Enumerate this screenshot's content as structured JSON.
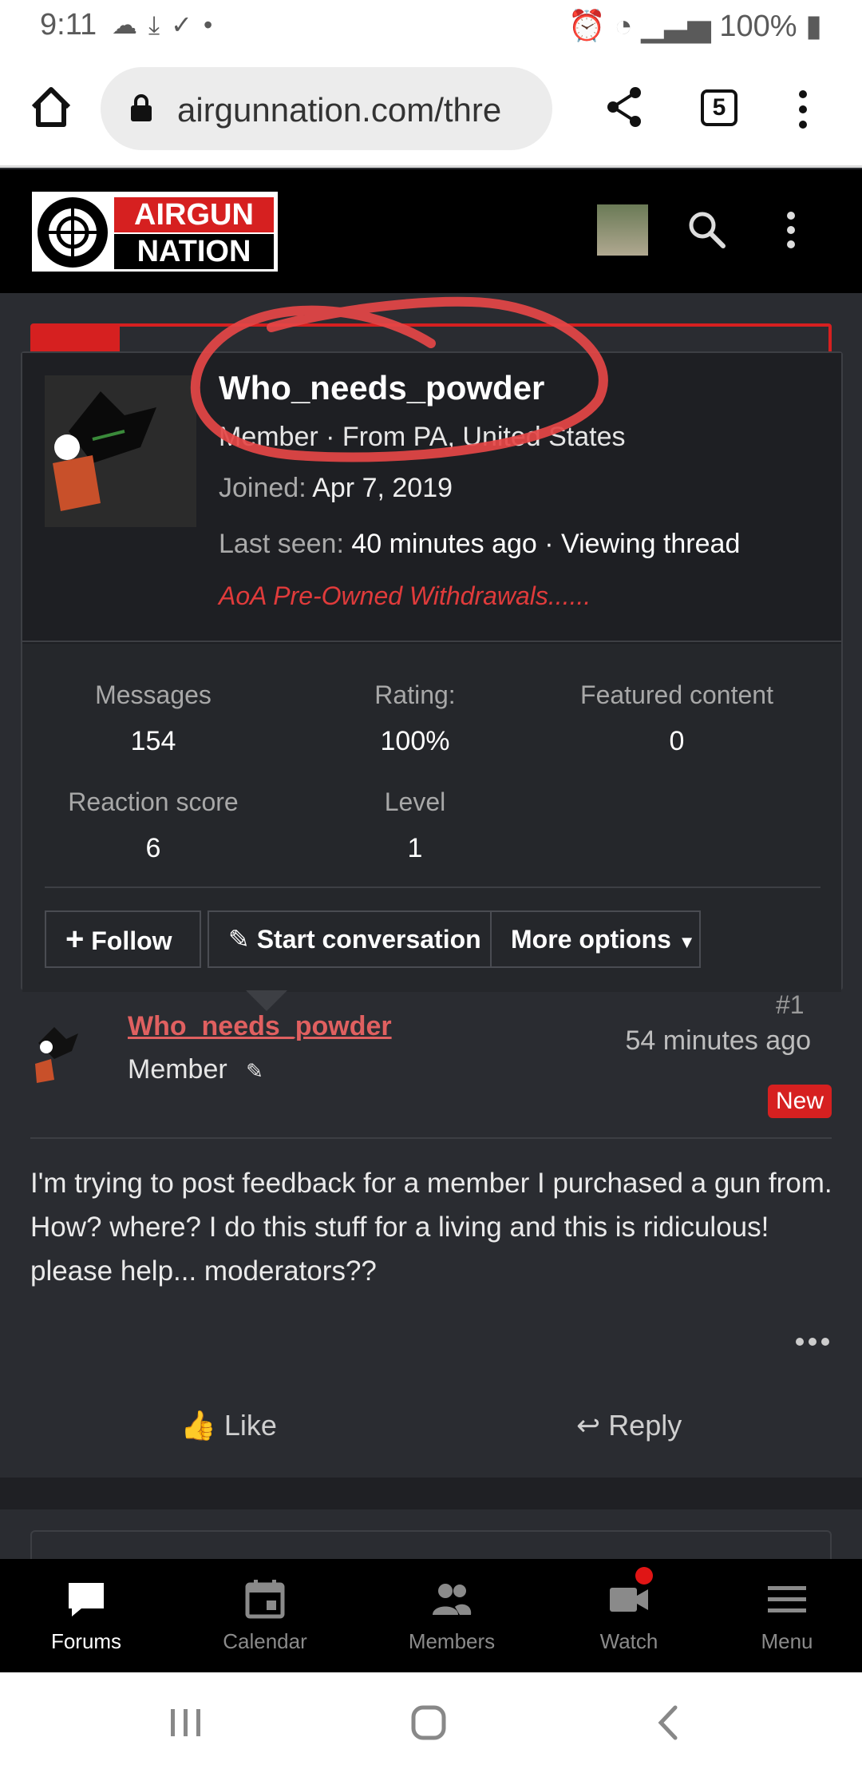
{
  "status": {
    "time": "9:11",
    "battery": "100%"
  },
  "browser": {
    "url": "airgunnation.com/thre",
    "tab_count": "5"
  },
  "site": {
    "logo_line1": "AIRGUN",
    "logo_line2": "NATION"
  },
  "popup": {
    "username": "Who_needs_powder",
    "title": "Member · From PA, United States",
    "joined_label": "Joined:",
    "joined_value": "Apr 7, 2019",
    "last_seen_label": "Last seen:",
    "last_seen_value": "40 minutes ago · Viewing thread",
    "thread": "AoA Pre-Owned Withdrawals......",
    "stats": [
      {
        "label": "Messages",
        "value": "154"
      },
      {
        "label": "Rating:",
        "value": "100%"
      },
      {
        "label": "Featured content",
        "value": "0"
      },
      {
        "label": "Reaction score",
        "value": "6"
      },
      {
        "label": "Level",
        "value": "1"
      }
    ],
    "buttons": {
      "follow": "Follow",
      "start_conversation": "Start conversation",
      "more_options": "More options"
    }
  },
  "post": {
    "number": "#1",
    "username": "Who_needs_powder",
    "role": "Member",
    "time": "54 minutes ago",
    "badge": "New",
    "body": "I'm trying to post feedback for a member I purchased a gun from. How? where? I do this stuff for a living and this is ridiculous! please help... moderators??",
    "like": "Like",
    "reply": "Reply"
  },
  "bottom_nav": [
    {
      "label": "Forums",
      "icon": "chat-bubble-icon",
      "active": true
    },
    {
      "label": "Calendar",
      "icon": "calendar-icon"
    },
    {
      "label": "Members",
      "icon": "members-icon"
    },
    {
      "label": "Watch",
      "icon": "video-camera-icon"
    },
    {
      "label": "Menu",
      "icon": "hamburger-icon"
    }
  ],
  "colors": {
    "accent": "#d62020",
    "username_link": "#e06060",
    "background": "#2a2c31"
  }
}
